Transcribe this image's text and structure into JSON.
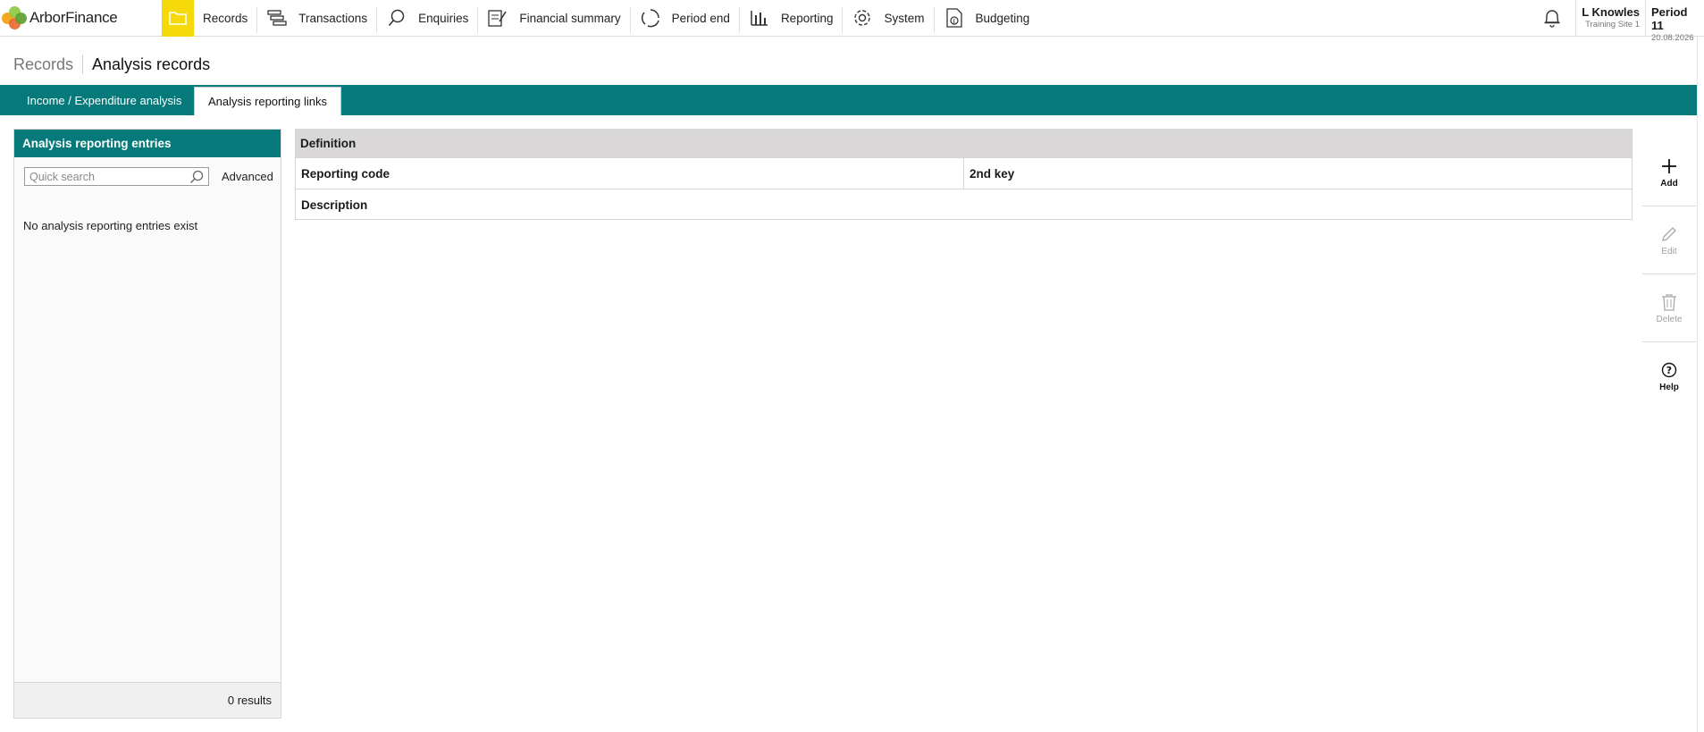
{
  "app": {
    "name": "ArborFinance"
  },
  "nav": {
    "items": [
      {
        "label": "Records",
        "icon": "folder-icon"
      },
      {
        "label": "Transactions",
        "icon": "transactions-icon"
      },
      {
        "label": "Enquiries",
        "icon": "search-icon"
      },
      {
        "label": "Financial summary",
        "icon": "summary-icon"
      },
      {
        "label": "Period end",
        "icon": "cycle-icon"
      },
      {
        "label": "Reporting",
        "icon": "bar-chart-icon"
      },
      {
        "label": "System",
        "icon": "gear-icon"
      },
      {
        "label": "Budgeting",
        "icon": "budget-icon"
      }
    ],
    "active_index": 0
  },
  "user": {
    "name": "L Knowles",
    "site": "Training Site 1"
  },
  "period": {
    "label": "Period 11",
    "date": "20.08.2026"
  },
  "breadcrumb": {
    "parent": "Records",
    "current": "Analysis records"
  },
  "tabs": [
    {
      "label": "Income / Expenditure analysis",
      "active": false
    },
    {
      "label": "Analysis reporting links",
      "active": true
    }
  ],
  "left_panel": {
    "title": "Analysis reporting entries",
    "search_placeholder": "Quick search",
    "advanced_label": "Advanced",
    "empty_message": "No analysis reporting entries exist",
    "results": "0 results"
  },
  "definition": {
    "title": "Definition",
    "reporting_code_label": "Reporting code",
    "second_key_label": "2nd key",
    "description_label": "Description"
  },
  "actions": [
    {
      "label": "Add",
      "icon": "plus-icon",
      "enabled": true
    },
    {
      "label": "Edit",
      "icon": "pencil-icon",
      "enabled": false
    },
    {
      "label": "Delete",
      "icon": "trash-icon",
      "enabled": false
    },
    {
      "label": "Help",
      "icon": "help-icon",
      "enabled": true
    }
  ],
  "colors": {
    "teal": "#067a7a",
    "active_nav": "#f5d90a",
    "header_grey": "#d9d7d7"
  }
}
